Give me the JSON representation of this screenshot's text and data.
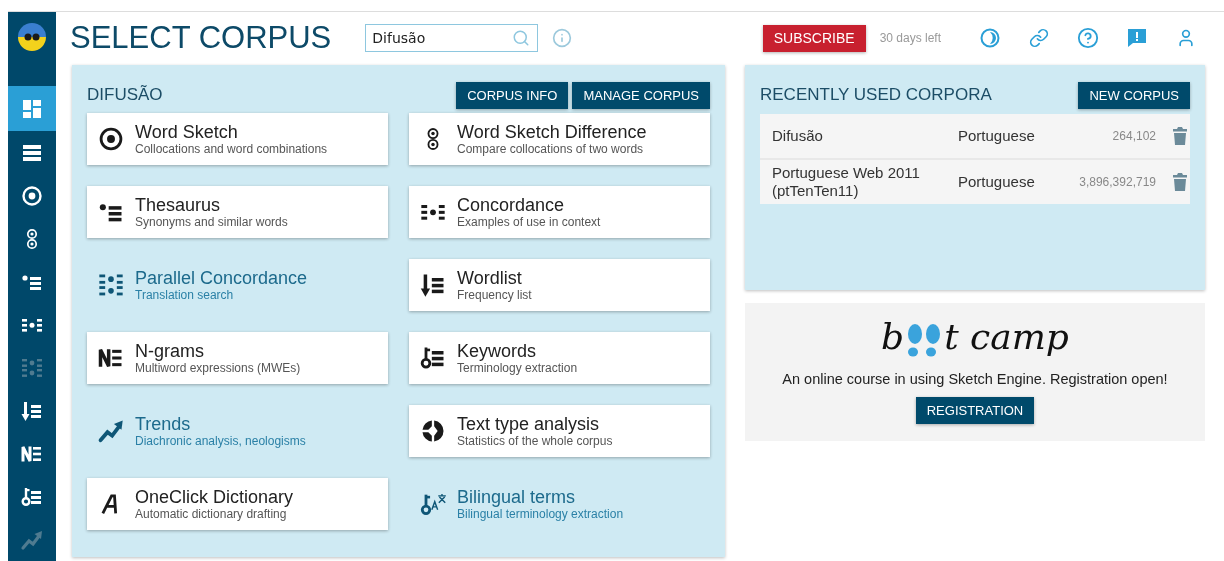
{
  "sidebar": {
    "items": [
      {
        "kind": "dashboard",
        "selected": true,
        "disabled": false
      },
      {
        "kind": "corpus-list",
        "selected": false,
        "disabled": false
      },
      {
        "kind": "word-sketch",
        "selected": false,
        "disabled": false
      },
      {
        "kind": "word-sketch-difference",
        "selected": false,
        "disabled": false
      },
      {
        "kind": "thesaurus",
        "selected": false,
        "disabled": false
      },
      {
        "kind": "concordance",
        "selected": false,
        "disabled": false
      },
      {
        "kind": "parallel",
        "selected": false,
        "disabled": true
      },
      {
        "kind": "wordlist",
        "selected": false,
        "disabled": false
      },
      {
        "kind": "ngrams",
        "selected": false,
        "disabled": false
      },
      {
        "kind": "keywords",
        "selected": false,
        "disabled": false
      },
      {
        "kind": "trends",
        "selected": false,
        "disabled": true
      }
    ]
  },
  "header": {
    "title": "SELECT CORPUS",
    "search": {
      "value": "Difusão"
    },
    "subscribe": "SUBSCRIBE",
    "trial": "30 days left"
  },
  "corpus_panel": {
    "title": "DIFUSÃO",
    "buttons": [
      "CORPUS INFO",
      "MANAGE CORPUS"
    ],
    "tools": [
      {
        "kind": "word-sketch",
        "available": true,
        "title": "Word Sketch",
        "subtitle": "Collocations and word combinations"
      },
      {
        "kind": "word-sketch-difference",
        "available": true,
        "title": "Word Sketch Difference",
        "subtitle": "Compare collocations of two words"
      },
      {
        "kind": "thesaurus",
        "available": true,
        "title": "Thesaurus",
        "subtitle": "Synonyms and similar words"
      },
      {
        "kind": "concordance",
        "available": true,
        "title": "Concordance",
        "subtitle": "Examples of use in context"
      },
      {
        "kind": "parallel",
        "available": false,
        "title": "Parallel Concordance",
        "subtitle": "Translation search"
      },
      {
        "kind": "wordlist",
        "available": true,
        "title": "Wordlist",
        "subtitle": "Frequency list"
      },
      {
        "kind": "ngrams",
        "available": true,
        "title": "N-grams",
        "subtitle": "Multiword expressions (MWEs)"
      },
      {
        "kind": "keywords",
        "available": true,
        "title": "Keywords",
        "subtitle": "Terminology extraction"
      },
      {
        "kind": "trends",
        "available": false,
        "title": "Trends",
        "subtitle": "Diachronic analysis, neologisms"
      },
      {
        "kind": "text-type",
        "available": true,
        "title": "Text type analysis",
        "subtitle": "Statistics of the whole corpus"
      },
      {
        "kind": "dictionary",
        "available": true,
        "title": "OneClick Dictionary",
        "subtitle": "Automatic dictionary drafting"
      },
      {
        "kind": "bilingual",
        "available": false,
        "title": "Bilingual terms",
        "subtitle": "Bilingual terminology extraction"
      }
    ]
  },
  "recent_panel": {
    "title": "RECENTLY USED CORPORA",
    "button": "NEW CORPUS",
    "rows": [
      {
        "name": "Difusão",
        "language": "Portuguese",
        "size": "264,102"
      },
      {
        "name": "Portuguese Web 2011 (ptTenTen11)",
        "language": "Portuguese",
        "size": "3,896,392,719"
      }
    ]
  },
  "bootcamp": {
    "logo_start": "b",
    "logo_end": "t camp",
    "text": "An online course in using Sketch Engine. Registration open!",
    "button": "REGISTRATION"
  }
}
